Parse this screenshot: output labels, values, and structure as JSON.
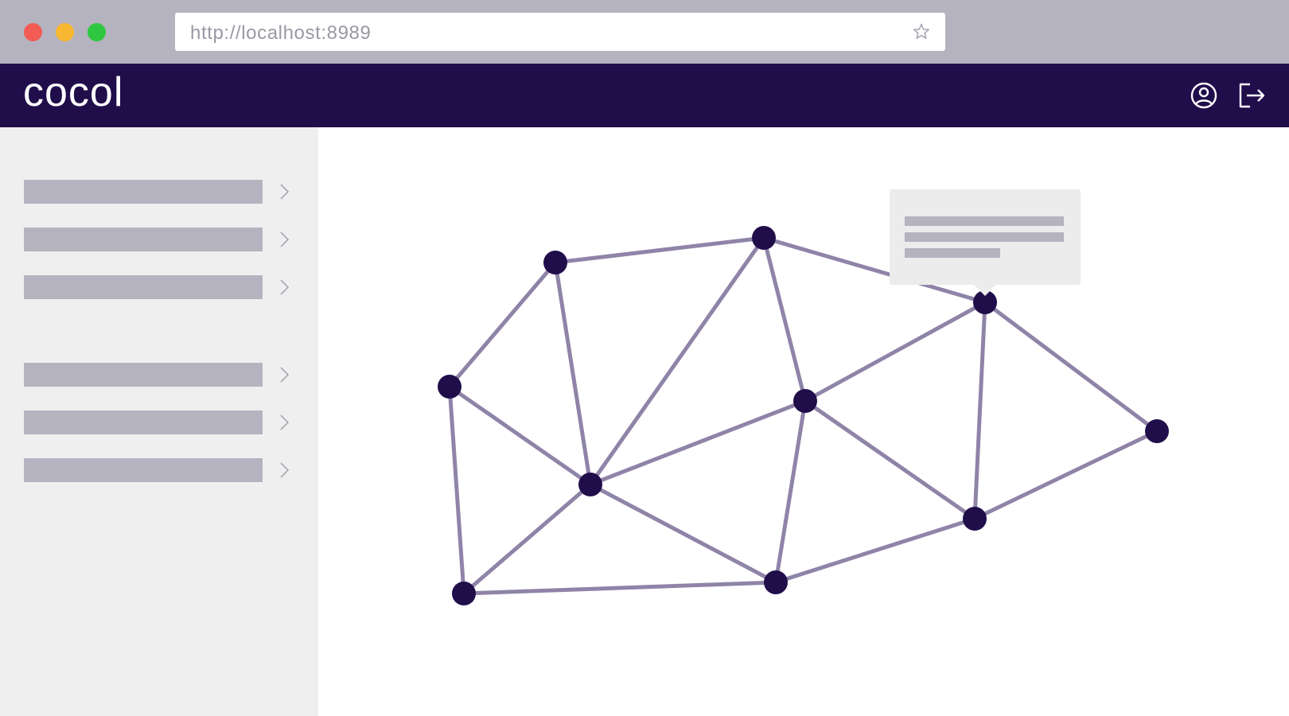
{
  "browser": {
    "url": "http://localhost:8989",
    "star_icon": "star-icon",
    "traffic_lights": {
      "close": "#f25c54",
      "minimize": "#f7b731",
      "maximize": "#2ec840"
    }
  },
  "colors": {
    "chrome": "#b5b3bf",
    "header": "#200e4b",
    "sidebar": "#efefef",
    "placeholder": "#b5b3bf",
    "node": "#200e4b",
    "edge": "#8f84a8"
  },
  "header": {
    "logo": "cocol",
    "user_icon": "user-circle-icon",
    "logout_icon": "logout-icon"
  },
  "sidebar": {
    "groups": [
      {
        "items": [
          {
            "icon": "chevron-right-icon"
          },
          {
            "icon": "chevron-right-icon"
          },
          {
            "icon": "chevron-right-icon"
          }
        ]
      },
      {
        "items": [
          {
            "icon": "chevron-right-icon"
          },
          {
            "icon": "chevron-right-icon"
          },
          {
            "icon": "chevron-right-icon"
          }
        ]
      }
    ]
  },
  "graph": {
    "nodes": [
      "n0",
      "n1",
      "n2",
      "n3",
      "n4",
      "n5",
      "n6",
      "n7",
      "n8",
      "n9",
      "n10",
      "n11"
    ],
    "edges": [
      [
        "n0",
        "n1"
      ],
      [
        "n1",
        "n2"
      ],
      [
        "n0",
        "n2"
      ],
      [
        "n2",
        "n3"
      ],
      [
        "n3",
        "n4"
      ],
      [
        "n3",
        "n5"
      ],
      [
        "n4",
        "n5"
      ],
      [
        "n2",
        "n5"
      ],
      [
        "n4",
        "n6"
      ],
      [
        "n5",
        "n7"
      ],
      [
        "n5",
        "n8"
      ],
      [
        "n6",
        "n7"
      ],
      [
        "n6",
        "n8"
      ],
      [
        "n7",
        "n9"
      ],
      [
        "n8",
        "n9"
      ],
      [
        "n9",
        "n10"
      ],
      [
        "n9",
        "n11"
      ],
      [
        "n10",
        "n11"
      ],
      [
        "n8",
        "n11"
      ],
      [
        "n11",
        "n9"
      ]
    ],
    "selected_node": "n7",
    "tooltip": {
      "lines": 3
    }
  }
}
